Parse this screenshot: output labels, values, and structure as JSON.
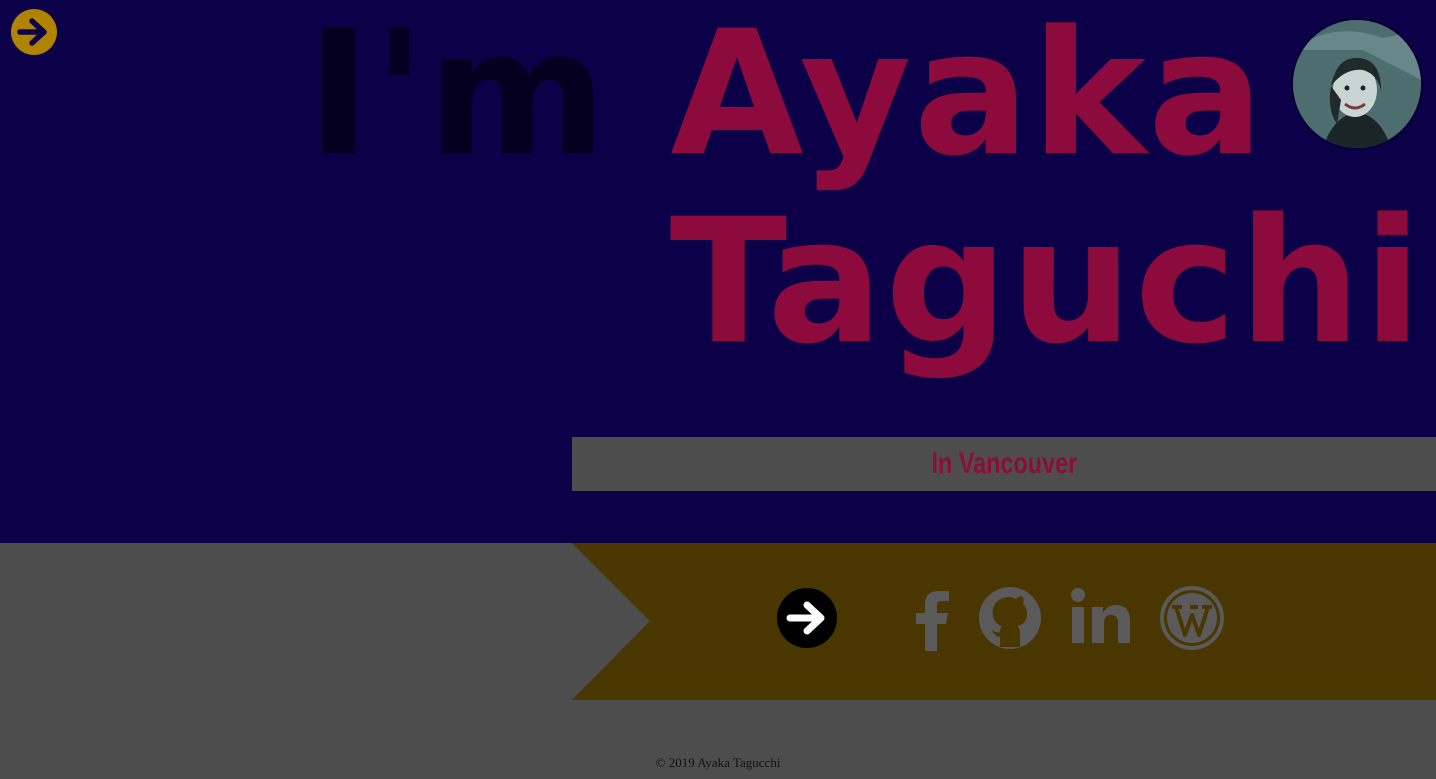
{
  "hero": {
    "greeting": "I'm",
    "first_name": "Ayaka",
    "last_name": "Taguchi",
    "location": "In Vancouver"
  },
  "icons": {
    "menu": "arrow-right-circle-icon",
    "next": "arrow-right-circle-icon",
    "social": [
      "facebook-icon",
      "github-icon",
      "linkedin-icon",
      "wordpress-icon"
    ]
  },
  "colors": {
    "hero_bg": "#0c0049",
    "name": "#8c0a3c",
    "accent": "#b08400",
    "band": "#4a3600",
    "footer_bg": "#4d4d4d"
  },
  "footer": {
    "copyright": "© 2019 Ayaka Tagucchi"
  }
}
